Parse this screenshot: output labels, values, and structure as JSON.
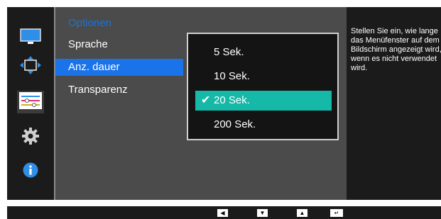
{
  "rail": {
    "icons": [
      "monitor-icon",
      "position-icon",
      "sliders-icon",
      "gear-icon",
      "info-icon"
    ],
    "selected_index": 2
  },
  "section": {
    "title": "Optionen"
  },
  "menu": {
    "items": [
      {
        "label": "Sprache"
      },
      {
        "label": "Anz. dauer"
      },
      {
        "label": "Transparenz"
      }
    ],
    "active_index": 1
  },
  "dropdown": {
    "options": [
      {
        "label": "5 Sek."
      },
      {
        "label": "10 Sek."
      },
      {
        "label": "20 Sek."
      },
      {
        "label": "200 Sek."
      }
    ],
    "selected_index": 2
  },
  "help": {
    "text": "Stellen Sie ein, wie lange das Menüfenster auf dem Bildschirm angezeigt wird, wenn es nicht verwendet wird."
  },
  "controls": [
    "left-arrow-icon",
    "down-arrow-icon",
    "up-arrow-icon",
    "enter-icon"
  ],
  "colors": {
    "accent_blue": "#1a73e8",
    "section_title": "#1a73d6",
    "selected_option": "#16b8a8"
  }
}
